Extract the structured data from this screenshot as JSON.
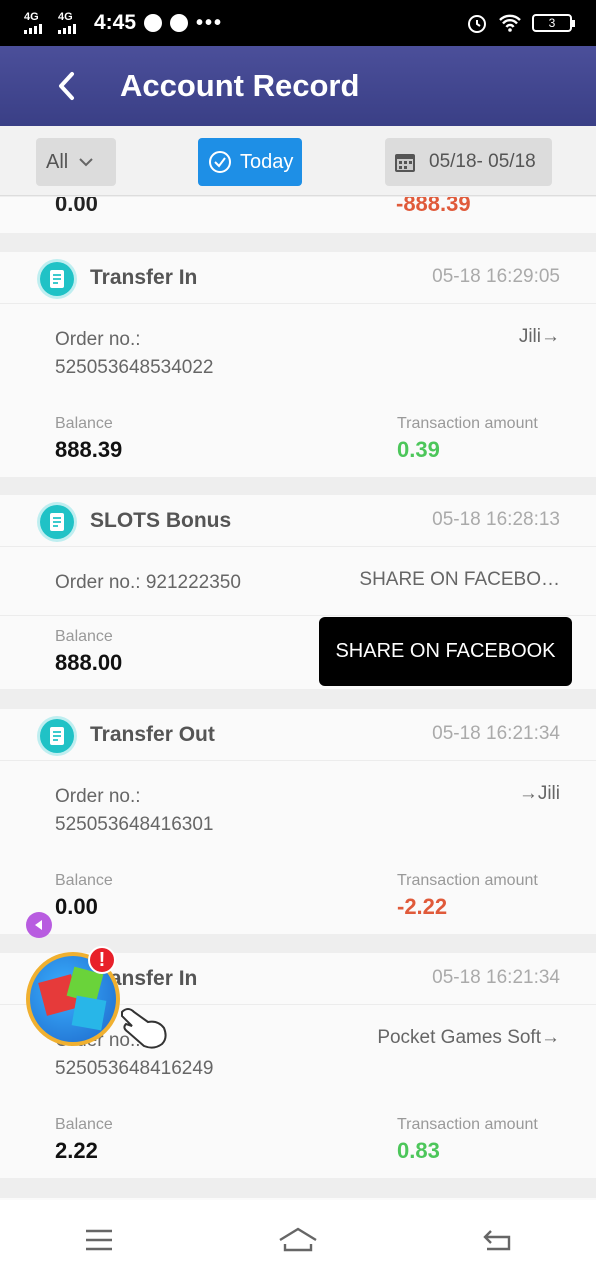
{
  "status_bar": {
    "signal1": "4G",
    "signal2": "4G",
    "time": "4:45",
    "battery": "3"
  },
  "header": {
    "title": "Account Record",
    "back_icon": "chevron-left-icon"
  },
  "filters": {
    "category": "All",
    "today_label": "Today",
    "date_range": "05/18- 05/18"
  },
  "partial_record": {
    "balance": "0.00",
    "amount": "-888.39"
  },
  "records": [
    {
      "type": "Transfer In",
      "time": "05-18 16:29:05",
      "order_label": "Order no.:",
      "order_no": "525053648534022",
      "target": "Jili→",
      "balance_label": "Balance",
      "balance": "888.39",
      "amount_label": "Transaction amount",
      "amount": "0.39"
    },
    {
      "type": "SLOTS Bonus",
      "time": "05-18 16:28:13",
      "order_line": "Order no.: 921222350",
      "target": "SHARE ON FACEBO…",
      "balance_label": "Balance",
      "balance": "888.00"
    },
    {
      "type": "Transfer Out",
      "time": "05-18 16:21:34",
      "order_label": "Order no.:",
      "order_no": "525053648416301",
      "target": "→Jili",
      "balance_label": "Balance",
      "balance": "0.00",
      "amount_label": "Transaction amount",
      "amount": "-2.22"
    },
    {
      "type": "Transfer In",
      "time": "05-18 16:21:34",
      "order_label": "Order no.:",
      "order_no": "525053648416249",
      "target": "Pocket Games Soft→",
      "balance_label": "Balance",
      "balance": "2.22",
      "amount_label": "Transaction amount",
      "amount": "0.83"
    }
  ],
  "share_button": "SHARE ON FACEBOOK",
  "floating_widget": {
    "badge": "!"
  },
  "colors": {
    "header": "#3f4490",
    "accent": "#1e8fe6",
    "positive": "#4cc65a",
    "negative": "#e05a3a"
  }
}
